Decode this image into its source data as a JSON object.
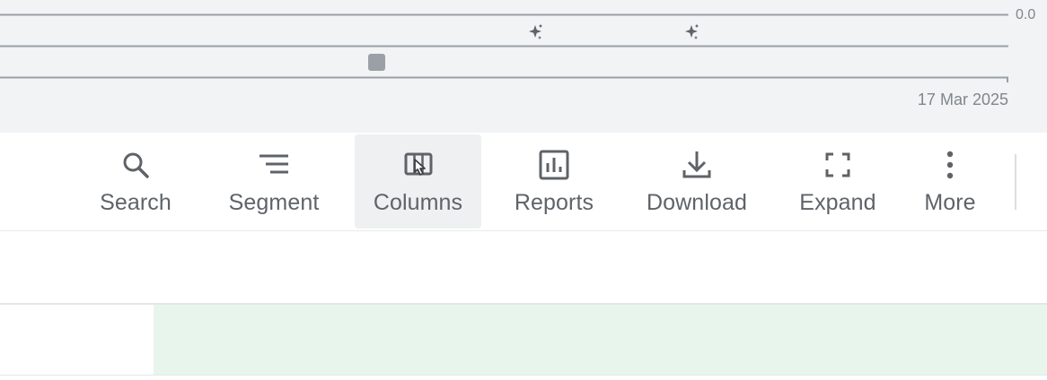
{
  "chart": {
    "y_tick_label": "0.0",
    "x_tick_label": "17 Mar 2025"
  },
  "toolbar": {
    "items": [
      {
        "label": "Search",
        "icon": "search-icon",
        "active": false
      },
      {
        "label": "Segment",
        "icon": "segment-icon",
        "active": false
      },
      {
        "label": "Columns",
        "icon": "columns-icon",
        "active": true
      },
      {
        "label": "Reports",
        "icon": "reports-icon",
        "active": false
      },
      {
        "label": "Download",
        "icon": "download-icon",
        "active": false
      },
      {
        "label": "Expand",
        "icon": "expand-icon",
        "active": false
      },
      {
        "label": "More",
        "icon": "more-vert-icon",
        "active": false
      }
    ]
  },
  "table": {
    "highlight_color": "#e8f5ec"
  },
  "colors": {
    "chart_background": "#f1f3f4",
    "gridline": "#9aa0a6",
    "icon": "#5f6368",
    "active_tool_background": "#eef0f1"
  }
}
